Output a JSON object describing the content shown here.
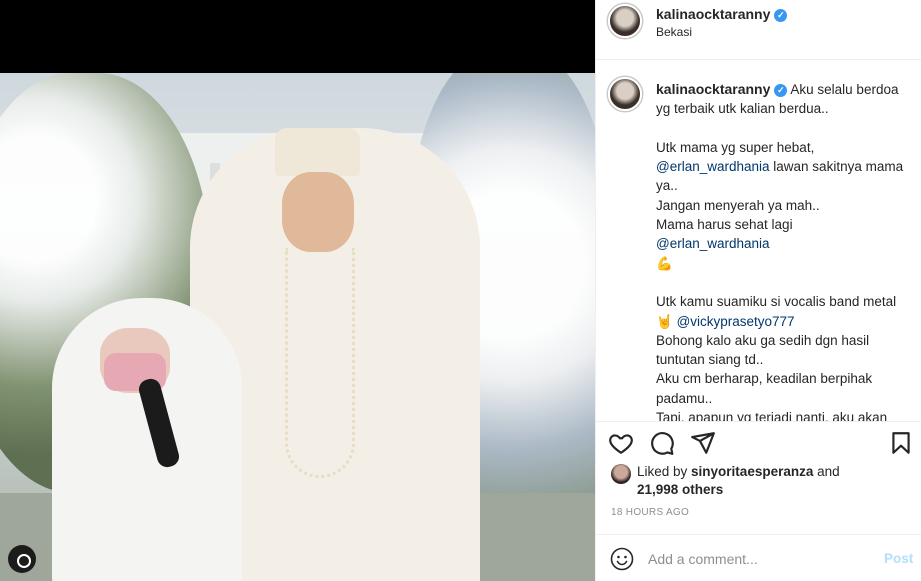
{
  "post": {
    "username": "kalinaocktaranny",
    "location": "Bekasi",
    "more_icon": "more-horizontal-icon"
  },
  "caption": {
    "username": "kalinaocktaranny",
    "line1": " Aku selalu berdoa yg terbaik utk kalian berdua..",
    "line2": "Utk mama yg super hebat,",
    "mention1": "@erlan_wardhania",
    "line3": " lawan sakitnya mama ya..\nJangan menyerah ya mah..\nMama harus sehat lagi\n",
    "mention2": "@erlan_wardhania",
    "emoji1": "💪",
    "line4": "Utk kamu suamiku si vocalis band metal 🤘 ",
    "mention3": "@vickyprasetyo777",
    "line5": "Bohong kalo aku ga sedih dgn hasil tuntutan siang td..\nAku cm berharap, keadilan berpihak padamu..\nTapi, apapun yg terjadi nanti, aku akan selalu mensupport km sayang"
  },
  "likes": {
    "prefix": "Liked by ",
    "user": "sinyoritaesperanza",
    "suffix": " and",
    "count": "21,998 others"
  },
  "timestamp": "18 HOURS AGO",
  "comment_box": {
    "placeholder": "Add a comment...",
    "post_label": "Post"
  },
  "colors": {
    "verified": "#3897f0",
    "mention": "#00376b",
    "post_disabled": "#b2dffc"
  }
}
